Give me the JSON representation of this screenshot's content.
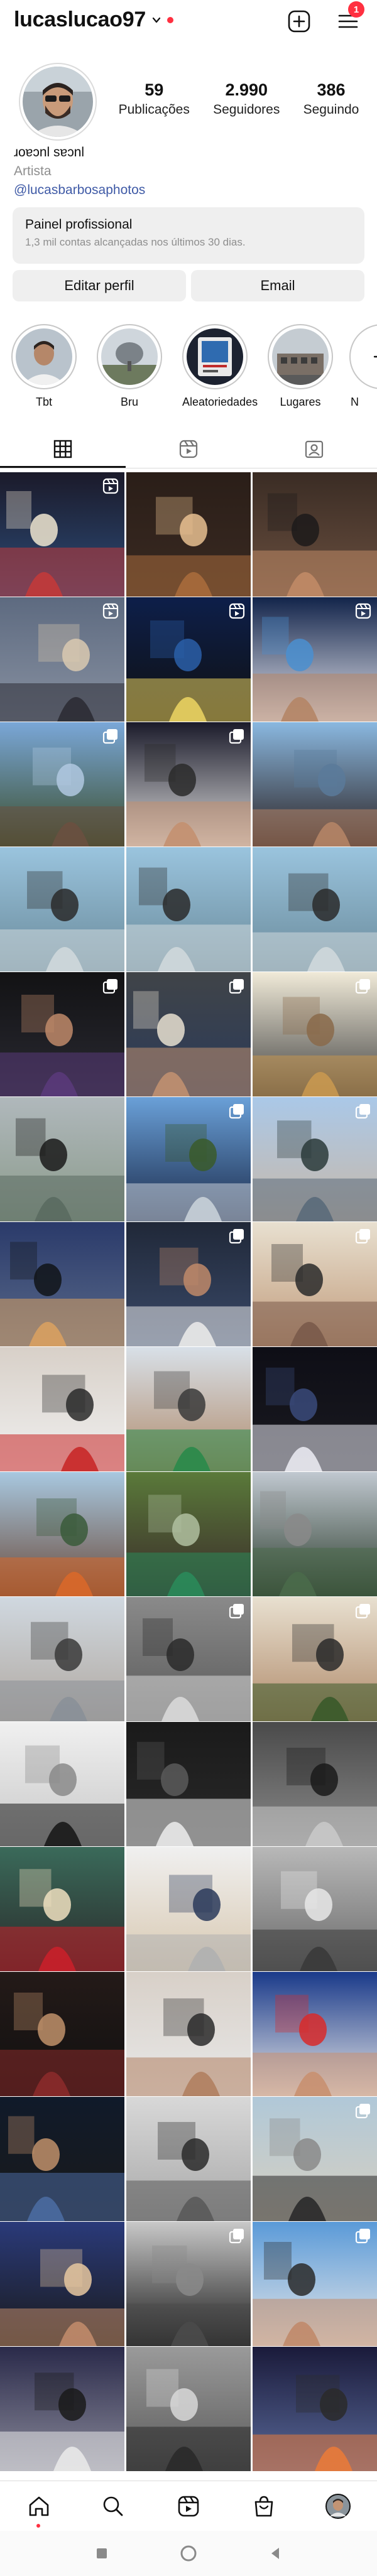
{
  "header": {
    "username": "lucaslucao97",
    "notification_count": "1",
    "icons": [
      "chevron-down-icon",
      "new-post-icon",
      "menu-icon"
    ]
  },
  "profile": {
    "stats": [
      {
        "value": "59",
        "label": "Publicações"
      },
      {
        "value": "2.990",
        "label": "Seguidores"
      },
      {
        "value": "386",
        "label": "Seguindo"
      }
    ],
    "name": "ɹoɐɔnl sɐɔnl",
    "category": "Artista",
    "link": "@lucasbarbosaphotos"
  },
  "pro_panel": {
    "title": "Painel profissional",
    "subtitle": "1,3 mil contas alcançadas nos últimos 30 dias."
  },
  "buttons": {
    "edit": "Editar perfil",
    "email": "Email"
  },
  "highlights": [
    {
      "label": "Tbt"
    },
    {
      "label": "Bru"
    },
    {
      "label": "Aleatoriedades"
    },
    {
      "label": "Lugares"
    },
    {
      "label": "N"
    }
  ],
  "tabs": [
    "grid-icon",
    "reels-icon",
    "tagged-icon"
  ],
  "grid": {
    "rows": 16,
    "columns": 3,
    "posts": [
      {
        "scene": "night-city",
        "badge": "reels"
      },
      {
        "scene": "group-night",
        "badge": ""
      },
      {
        "scene": "man-selfie-dark",
        "badge": ""
      },
      {
        "scene": "dusk-street",
        "badge": "reels"
      },
      {
        "scene": "stadium-night",
        "badge": "reels"
      },
      {
        "scene": "couple-blue",
        "badge": "reels"
      },
      {
        "scene": "couple-house",
        "badge": "multi"
      },
      {
        "scene": "man-selfie-night",
        "badge": "multi"
      },
      {
        "scene": "couple-sky",
        "badge": ""
      },
      {
        "scene": "man-river",
        "badge": ""
      },
      {
        "scene": "man-river",
        "badge": ""
      },
      {
        "scene": "man-river",
        "badge": ""
      },
      {
        "scene": "man-dark-room",
        "badge": "multi"
      },
      {
        "scene": "party-group",
        "badge": "multi"
      },
      {
        "scene": "party-table",
        "badge": "multi"
      },
      {
        "scene": "silhouette-river",
        "badge": ""
      },
      {
        "scene": "sculpture-blue",
        "badge": "multi"
      },
      {
        "scene": "city-towers",
        "badge": "multi"
      },
      {
        "scene": "night-trees",
        "badge": ""
      },
      {
        "scene": "man-night-city",
        "badge": "multi"
      },
      {
        "scene": "couple-indoor",
        "badge": "multi"
      },
      {
        "scene": "red-shirt",
        "badge": ""
      },
      {
        "scene": "friends-green",
        "badge": ""
      },
      {
        "scene": "obelisk-night",
        "badge": ""
      },
      {
        "scene": "orange-street",
        "badge": ""
      },
      {
        "scene": "green-bin",
        "badge": ""
      },
      {
        "scene": "plaza-aerial",
        "badge": ""
      },
      {
        "scene": "flower-statue",
        "badge": ""
      },
      {
        "scene": "monument-bw",
        "badge": "multi"
      },
      {
        "scene": "couple-park",
        "badge": "multi"
      },
      {
        "scene": "grenade-art",
        "badge": ""
      },
      {
        "scene": "night-road-bw",
        "badge": ""
      },
      {
        "scene": "group-selfie-bw",
        "badge": ""
      },
      {
        "scene": "man-mural",
        "badge": ""
      },
      {
        "scene": "man-hallway",
        "badge": ""
      },
      {
        "scene": "selfie-bw",
        "badge": ""
      },
      {
        "scene": "man-sitting-dark",
        "badge": ""
      },
      {
        "scene": "couple-selfie",
        "badge": ""
      },
      {
        "scene": "couple-selfie-2",
        "badge": ""
      },
      {
        "scene": "men-night",
        "badge": ""
      },
      {
        "scene": "man-bw-door",
        "badge": ""
      },
      {
        "scene": "man-rooftop",
        "badge": "multi"
      },
      {
        "scene": "group-selfie-color",
        "badge": ""
      },
      {
        "scene": "couple-bw",
        "badge": "multi"
      },
      {
        "scene": "man-smile-blue",
        "badge": "multi"
      },
      {
        "scene": "man-banner",
        "badge": ""
      },
      {
        "scene": "couple-bw-2",
        "badge": ""
      },
      {
        "scene": "sunset",
        "badge": ""
      }
    ]
  },
  "bottom_nav": [
    "home-icon",
    "search-icon",
    "reels-icon",
    "shop-icon",
    "profile-avatar"
  ],
  "colors": {
    "accent_link": "#3f5aa6",
    "notification_red": "#ff3040",
    "panel_bg": "#efefef"
  }
}
